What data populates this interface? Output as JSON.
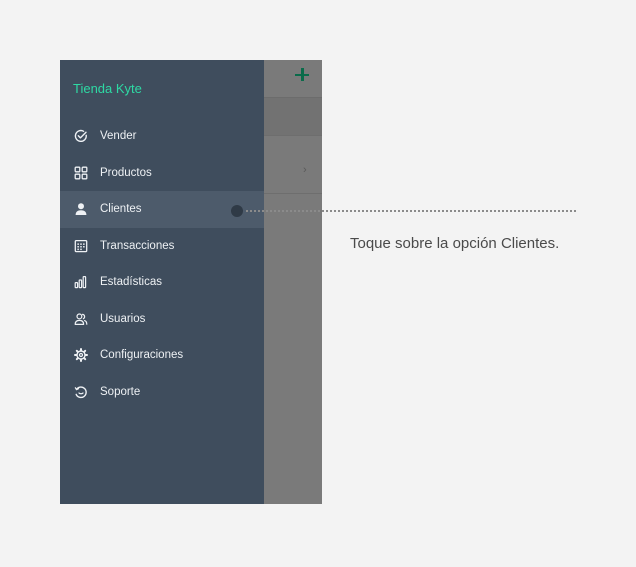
{
  "app": {
    "store_name": "Tienda Kyte",
    "row_chevron": "›"
  },
  "menu": {
    "items": [
      {
        "label": "Vender",
        "icon": "check-circle-icon"
      },
      {
        "label": "Productos",
        "icon": "grid-icon"
      },
      {
        "label": "Clientes",
        "icon": "user-icon",
        "active": true
      },
      {
        "label": "Transacciones",
        "icon": "calendar-icon"
      },
      {
        "label": "Estadísticas",
        "icon": "bar-chart-icon"
      },
      {
        "label": "Usuarios",
        "icon": "users-icon"
      },
      {
        "label": "Configuraciones",
        "icon": "gear-icon"
      },
      {
        "label": "Soporte",
        "icon": "support-icon"
      }
    ]
  },
  "callout": {
    "text": "Toque sobre la opción Clientes."
  },
  "colors": {
    "accent": "#2ed9a4",
    "drawer": "#3f4d5d",
    "active_item": "#4d5b6b",
    "add_button": "#0a6b4a"
  }
}
